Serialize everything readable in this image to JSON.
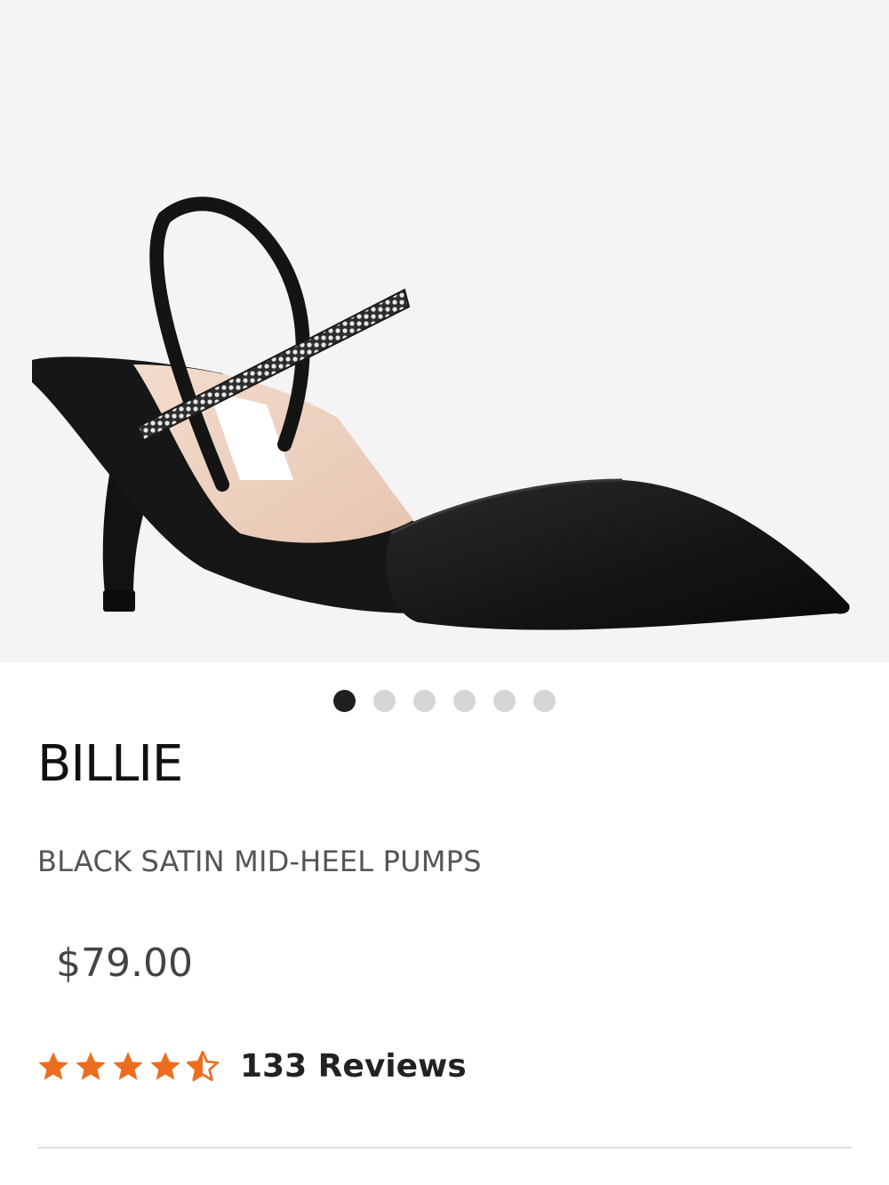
{
  "product": {
    "name": "BILLIE",
    "description": "BLACK SATIN MID-HEEL PUMPS",
    "price": "$79.00"
  },
  "gallery": {
    "image_count": 6,
    "active_index": 0,
    "image_subject": "shoe-image"
  },
  "rating": {
    "stars_value": 4.5,
    "stars_max": 5,
    "reviews_label": "133 Reviews",
    "star_color": "#ed6d1f"
  },
  "colors": {
    "hero_background": "#f4f4f4",
    "dot_active": "#1f1f1f",
    "dot_inactive": "#d6d6d6"
  }
}
